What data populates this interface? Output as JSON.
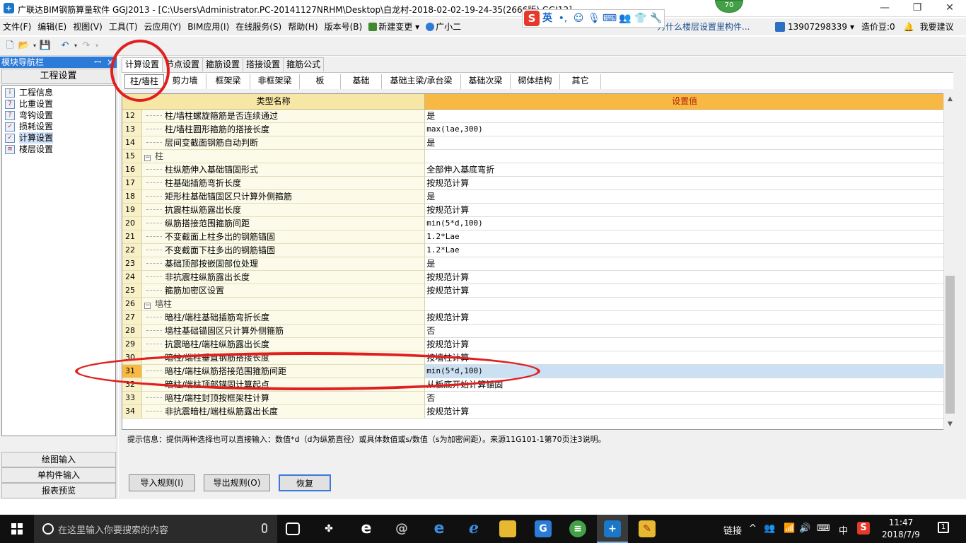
{
  "window": {
    "title": "广联达BIM钢筋算量软件 GGJ2013 - [C:\\Users\\Administrator.PC-20141127NRHM\\Desktop\\白龙村-2018-02-02-19-24-35(2666版).GGJ12]",
    "badge": "70",
    "minimize": "—",
    "restore": "❐",
    "close": "✕"
  },
  "ime": {
    "logo": "S",
    "mode": "英"
  },
  "menu": {
    "items": [
      "文件(F)",
      "编辑(E)",
      "视图(V)",
      "工具(T)",
      "云应用(Y)",
      "BIM应用(I)",
      "在线服务(S)",
      "帮助(H)",
      "版本号(B)"
    ],
    "new_change": "新建变更",
    "new_change_arrow": "▾",
    "assistant": "广小二",
    "hint_link": "为什么楼层设置里构件...",
    "phone": "13907298339",
    "phone_arrow": "▾",
    "coins": "造价豆:0",
    "feedback": "我要建议"
  },
  "nav": {
    "title": "模块导航栏",
    "pin": "ꟷ",
    "close": "×",
    "section": "工程设置",
    "items": [
      {
        "label": "工程信息",
        "icon": "info-icon",
        "glyph": "i"
      },
      {
        "label": "比重设置",
        "icon": "weight-icon",
        "glyph": "7"
      },
      {
        "label": "弯钩设置",
        "icon": "hook-icon",
        "glyph": "?"
      },
      {
        "label": "损耗设置",
        "icon": "loss-icon",
        "glyph": "✓"
      },
      {
        "label": "计算设置",
        "icon": "calc-icon",
        "glyph": "✓"
      },
      {
        "label": "楼层设置",
        "icon": "floor-icon",
        "glyph": "≡"
      }
    ],
    "selected_index": 4,
    "bottom": [
      "绘图输入",
      "单构件输入",
      "报表预览"
    ]
  },
  "tabs": [
    "计算设置",
    "节点设置",
    "箍筋设置",
    "搭接设置",
    "箍筋公式"
  ],
  "active_tab": 0,
  "subtabs": [
    "柱/墙柱",
    "剪力墙",
    "框架梁",
    "非框架梁",
    "板",
    "基础",
    "基础主梁/承台梁",
    "基础次梁",
    "砌体结构",
    "其它"
  ],
  "active_subtab": 0,
  "grid": {
    "col_name": "类型名称",
    "col_value": "设置值",
    "collapse_glyph": "−",
    "rows": [
      {
        "no": "12",
        "name": "柱/墙柱螺旋箍筋是否连续通过",
        "value": "是"
      },
      {
        "no": "13",
        "name": "柱/墙柱圆形箍筋的搭接长度",
        "value": "max(lae,300)"
      },
      {
        "no": "14",
        "name": "层间变截面钢筋自动判断",
        "value": "是"
      },
      {
        "no": "15",
        "name": "柱",
        "value": "",
        "group": true
      },
      {
        "no": "16",
        "name": "柱纵筋伸入基础锚固形式",
        "value": "全部伸入基底弯折"
      },
      {
        "no": "17",
        "name": "柱基础插筋弯折长度",
        "value": "按规范计算"
      },
      {
        "no": "18",
        "name": "矩形柱基础锚固区只计算外侧箍筋",
        "value": "是"
      },
      {
        "no": "19",
        "name": "抗震柱纵筋露出长度",
        "value": "按规范计算"
      },
      {
        "no": "20",
        "name": "纵筋搭接范围箍筋间距",
        "value": "min(5*d,100)"
      },
      {
        "no": "21",
        "name": "不变截面上柱多出的钢筋锚固",
        "value": "1.2*Lae"
      },
      {
        "no": "22",
        "name": "不变截面下柱多出的钢筋锚固",
        "value": "1.2*Lae"
      },
      {
        "no": "23",
        "name": "基础顶部按嵌固部位处理",
        "value": "是"
      },
      {
        "no": "24",
        "name": "非抗震柱纵筋露出长度",
        "value": "按规范计算"
      },
      {
        "no": "25",
        "name": "箍筋加密区设置",
        "value": "按规范计算"
      },
      {
        "no": "26",
        "name": "墙柱",
        "value": "",
        "group": true
      },
      {
        "no": "27",
        "name": "暗柱/端柱基础插筋弯折长度",
        "value": "按规范计算"
      },
      {
        "no": "28",
        "name": "墙柱基础锚固区只计算外侧箍筋",
        "value": "否"
      },
      {
        "no": "29",
        "name": "抗震暗柱/端柱纵筋露出长度",
        "value": "按规范计算"
      },
      {
        "no": "30",
        "name": "暗柱/端柱垂直钢筋搭接长度",
        "value": "按墙柱计算"
      },
      {
        "no": "31",
        "name": "暗柱/端柱纵筋搭接范围箍筋间距",
        "value": "min(5*d,100)",
        "selected": true
      },
      {
        "no": "32",
        "name": "暗柱/端柱顶部锚固计算起点",
        "value": "从板底开始计算锚固"
      },
      {
        "no": "33",
        "name": "暗柱/端柱封顶按框架柱计算",
        "value": "否"
      },
      {
        "no": "34",
        "name": "非抗震暗柱/端柱纵筋露出长度",
        "value": "按规范计算"
      }
    ]
  },
  "hint": "提示信息：提供两种选择也可以直接输入：数值*d（d为纵筋直径）或具体数值或s/数值（s为加密间距）。来源11G101-1第70页注3说明。",
  "buttons": {
    "import": "导入规则(I)",
    "export": "导出规则(O)",
    "restore": "恢复"
  },
  "taskbar": {
    "search_placeholder": "在这里输入你要搜索的内容",
    "tray_link": "链接",
    "tray_caret": "^",
    "ime": "中",
    "time": "11:47",
    "date": "2018/7/9",
    "notifications": "1"
  }
}
